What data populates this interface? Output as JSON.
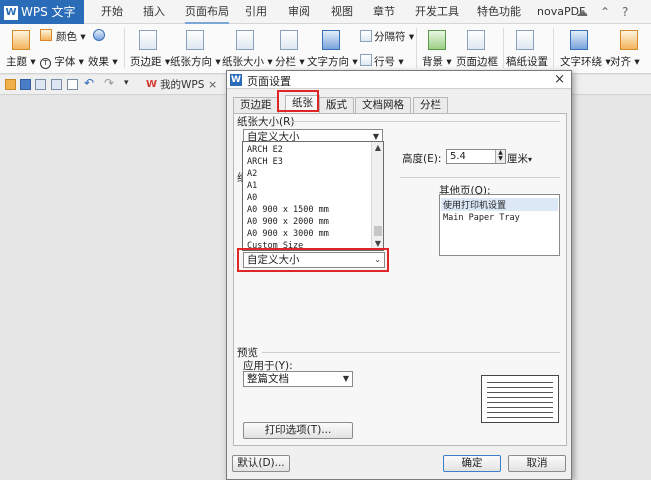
{
  "app": {
    "name": "WPS 文字",
    "menu_tabs": [
      "开始",
      "插入",
      "页面布局",
      "引用",
      "审阅",
      "视图",
      "章节",
      "开发工具",
      "特色功能",
      "novaPDF"
    ],
    "active_menu_tab": "页面布局"
  },
  "ribbon": {
    "row1": {
      "color": "颜色",
      "section_break": "分隔符"
    },
    "row2": {
      "theme": "主题",
      "font": "字体",
      "effects": "效果",
      "margins": "页边距",
      "orientation": "纸张方向",
      "paper_size": "纸张大小",
      "columns": "分栏",
      "text_direction": "文字方向",
      "line_numbers": "行号",
      "background": "背景",
      "page_border": "页面边框",
      "grid_paper": "稿纸设置",
      "text_wrap": "文字环绕",
      "align": "对齐"
    }
  },
  "doc_tab": {
    "label": "我的WPS",
    "close": "×"
  },
  "dialog": {
    "title": "页面设置",
    "close": "×",
    "tabs": [
      "页边距",
      "纸张",
      "版式",
      "文档网格",
      "分栏"
    ],
    "active_tab": "纸张",
    "paper_size_label": "纸张大小(R)",
    "paper_size_value": "自定义大小",
    "dropdown_options": [
      "ARCH E2",
      "ARCH E3",
      "A2",
      "A1",
      "A0",
      "A0 900 x 1500 mm",
      "A0 900 x 2000 mm",
      "A0 900 x 3000 mm",
      "Custom Size"
    ],
    "dropdown_selected": "自定义大小",
    "height_label": "高度(E):",
    "height_value": "5.4",
    "unit": "厘米",
    "paper_source_partial": "纸",
    "other_pages_label": "其他页(O):",
    "other_pages_items": [
      "使用打印机设置",
      "Main Paper Tray"
    ],
    "preview_label": "预览",
    "apply_to_label": "应用于(Y):",
    "apply_to_value": "整篇文档",
    "print_options_button": "打印选项(T)...",
    "default_button": "默认(D)...",
    "ok_button": "确定",
    "cancel_button": "取消"
  },
  "colors": {
    "accent": "#2b6cb8",
    "highlight": "#e02525",
    "list_selection": "#dce8f6"
  }
}
